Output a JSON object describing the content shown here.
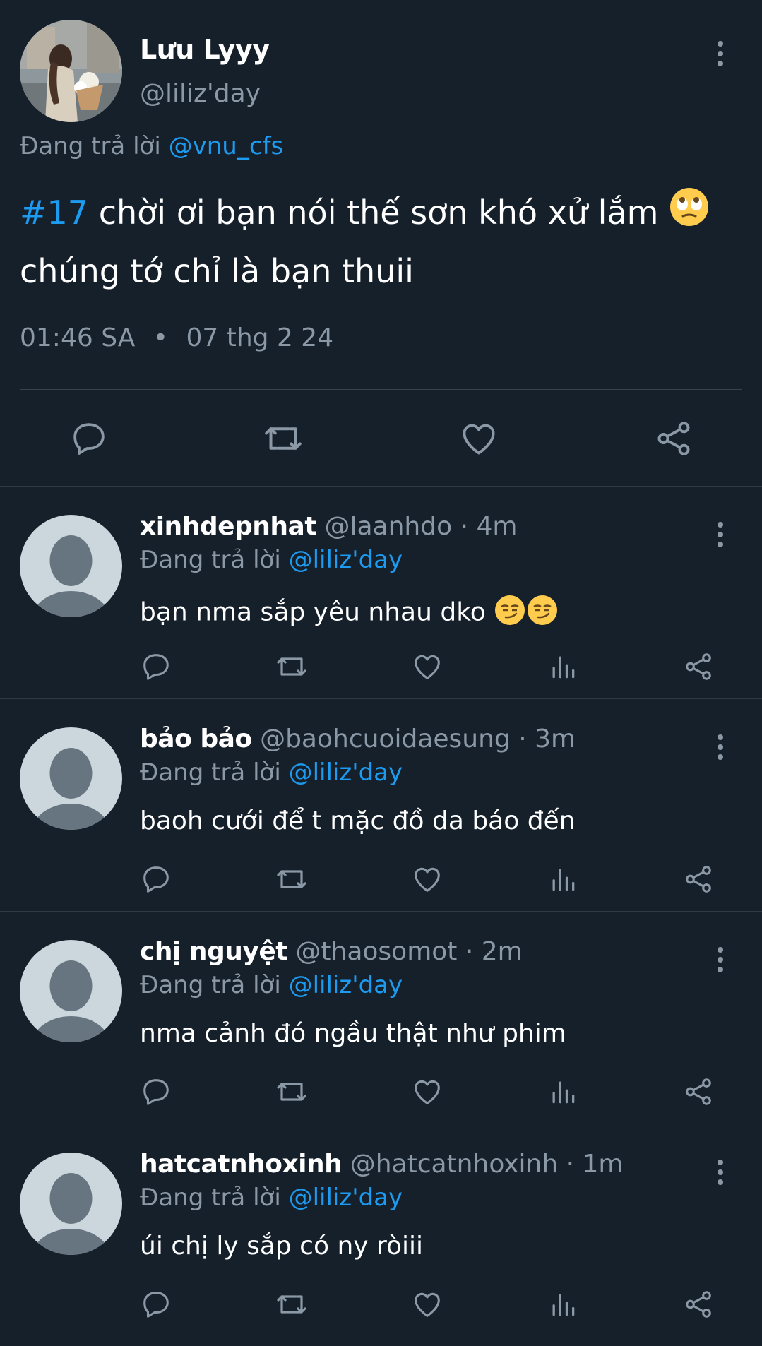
{
  "main_tweet": {
    "author_name": "Lưu Lyyy",
    "author_handle": "@liliz'day",
    "reply_prefix": "Đang trả lời",
    "reply_to": "@vnu_cfs",
    "hashtag": "#17",
    "text_line1": " chời ơi bạn nói thế sơn khó xử lắm ",
    "emoji": "🙄",
    "text_line2": "chúng tớ chỉ là bạn thuii",
    "time": "01:46 SA",
    "separator": "•",
    "date": "07 thg 2 24"
  },
  "replies": [
    {
      "name": "xinhdepnhat",
      "meta": " @laanhdo · 4m",
      "reply_prefix": "Đang trả lời",
      "reply_to": "@liliz'day",
      "text": "bạn nma sắp yêu nhau dko ",
      "emoji": "😏😏"
    },
    {
      "name": "bảo bảo",
      "meta": " @baohcuoidaesung · 3m",
      "reply_prefix": "Đang trả lời",
      "reply_to": "@liliz'day",
      "text": "baoh cưới để t mặc đồ da báo đến"
    },
    {
      "name": "chị nguyệt",
      "meta": " @thaosomot · 2m",
      "reply_prefix": "Đang trả lời",
      "reply_to": "@liliz'day",
      "text": "nma cảnh đó ngầu thật như phim"
    },
    {
      "name": "hatcatnhoxinh",
      "meta": " @hatcatnhoxinh · 1m",
      "reply_prefix": "Đang trả lời",
      "reply_to": "@liliz'day",
      "text": "úi chị ly sắp có ny ròiii"
    }
  ],
  "icons": {
    "reply": "reply-icon",
    "retweet": "retweet-icon",
    "like": "heart-icon",
    "analytics": "analytics-icon",
    "share": "share-icon",
    "more": "more-vertical-icon"
  },
  "colors": {
    "background": "#15202b",
    "accent": "#1d9bf0",
    "secondary_text": "#8b98a5",
    "divider": "#2f3a45"
  }
}
